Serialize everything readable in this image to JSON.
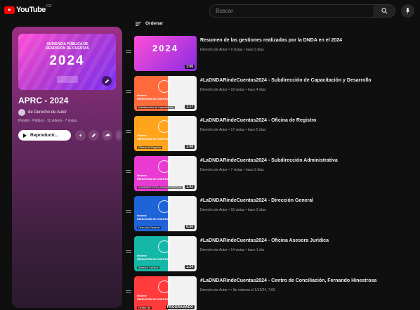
{
  "header": {
    "logo_text": "YouTube",
    "logo_sup": "CO",
    "search_placeholder": "Buscar"
  },
  "playlist": {
    "cover_header": "AUDIENCIA PÚBLICA DE RENDICIÓN DE CUENTAS",
    "cover_year": "2024",
    "title": "APRC - 2024",
    "owner": "de Derecho de Autor",
    "meta": "Playlist · Público · 11 videos · 7 vistas",
    "play_label": "Reproducir..."
  },
  "sort_label": "Ordenar",
  "videos": [
    {
      "title": "Resumen de las gestiones realizadas por la DNDA en el 2024",
      "meta": "Derecho de Autor • 9 vistas • hace 3 días",
      "duration": "1:06",
      "caption": ""
    },
    {
      "title": "#LaDNDARindeCuentas2024 - Subdirección de Capacitación y Desarrollo",
      "meta": "Derecho de Autor • 19 vistas • hace 4 días",
      "duration": "1:17",
      "caption": "Subdirección de Capacitación"
    },
    {
      "title": "#LaDNDARindeCuentas2024 - Oficina de Registro",
      "meta": "Derecho de Autor • 17 vistas • hace 5 días",
      "duration": "1:08",
      "caption": "Oficina de Registro"
    },
    {
      "title": "#LaDNDARindeCuentas2024 - Subdirección Administrativa",
      "meta": "Derecho de Autor • 7 vistas • hace 2 días",
      "duration": "1:02",
      "caption": "SUBDIRECCIÓN ADMINISTRATIVA"
    },
    {
      "title": "#LaDNDARindeCuentas2024 - Dirección General",
      "meta": "Derecho de Autor • 15 vistas • hace 2 días",
      "duration": "0:56",
      "caption": "Dirección General"
    },
    {
      "title": "#LaDNDARindeCuentas2024 - Oficina Asesora Jurídica",
      "meta": "Derecho de Autor • 14 vistas • hace 1 día",
      "duration": "1:24",
      "caption": "Asesora Jurídica"
    },
    {
      "title": "#LaDNDARindeCuentas2024 - Centro de Conciliación, Fernando Hinestrosa",
      "meta": "Derecho de Autor • • Se estrena el 1/12/24, 7:00",
      "duration": "PROGRAMADO",
      "caption": "Centro de"
    }
  ],
  "thumb_text": "Informe\nRENDICIÓN DE CUENTAS\nVigencia 2024",
  "colors": {
    "accent": "#ff0000",
    "thumb_1": "#c62ec2",
    "thumb_2": "#ff6a3d",
    "thumb_3": "#ffa41b",
    "thumb_4": "#e93bd1",
    "thumb_5": "#1e63d8",
    "thumb_6": "#15b8a6",
    "thumb_7": "#ff3b3b"
  }
}
